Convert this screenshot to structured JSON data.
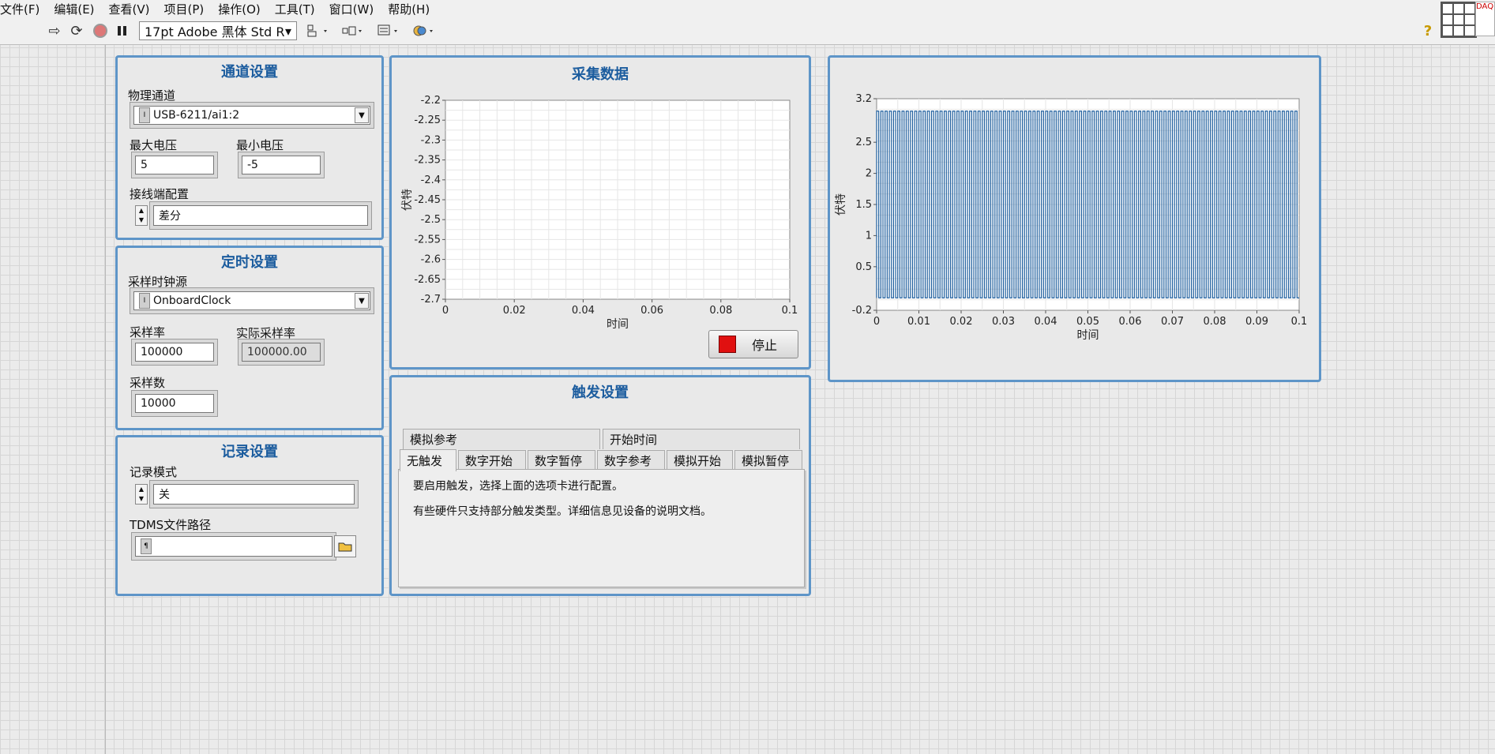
{
  "menu": [
    "文件(F)",
    "编辑(E)",
    "查看(V)",
    "项目(P)",
    "操作(O)",
    "工具(T)",
    "窗口(W)",
    "帮助(H)"
  ],
  "toolbar": {
    "font_selector": "17pt Adobe 黑体 Std R",
    "help_icon": "?"
  },
  "channel_panel": {
    "title": "通道设置",
    "physical_channel_label": "物理通道",
    "physical_channel_value": "USB-6211/ai1:2",
    "max_voltage_label": "最大电压",
    "max_voltage_value": "5",
    "min_voltage_label": "最小电压",
    "min_voltage_value": "-5",
    "terminal_config_label": "接线端配置",
    "terminal_config_value": "差分"
  },
  "timing_panel": {
    "title": "定时设置",
    "clock_source_label": "采样时钟源",
    "clock_source_value": "OnboardClock",
    "rate_label": "采样率",
    "rate_value": "100000",
    "actual_rate_label": "实际采样率",
    "actual_rate_value": "100000.00",
    "samples_label": "采样数",
    "samples_value": "10000"
  },
  "logging_panel": {
    "title": "记录设置",
    "mode_label": "记录模式",
    "mode_value": "关",
    "path_label": "TDMS文件路径",
    "path_value": ""
  },
  "acquire_panel": {
    "title": "采集数据",
    "stop_label": "停止"
  },
  "trigger_panel": {
    "title": "触发设置",
    "tabs_back": [
      "模拟参考",
      "开始时间"
    ],
    "tabs_front": [
      "无触发",
      "数字开始",
      "数字暂停",
      "数字参考",
      "模拟开始",
      "模拟暂停"
    ],
    "active_tab": "无触发",
    "line1": "要启用触发，选择上面的选项卡进行配置。",
    "line2": "有些硬件只支持部分触发类型。详细信息见设备的说明文档。"
  },
  "chart_data": [
    {
      "type": "line",
      "title": "",
      "xlabel": "时间",
      "ylabel": "伏特",
      "xlim": [
        0,
        0.1
      ],
      "ylim": [
        -2.7,
        -2.2
      ],
      "x_ticks": [
        "0",
        "0.02",
        "0.04",
        "0.06",
        "0.08",
        "0.1"
      ],
      "y_ticks": [
        "-2.2",
        "-2.25",
        "-2.3",
        "-2.35",
        "-2.4",
        "-2.45",
        "-2.5",
        "-2.55",
        "-2.6",
        "-2.65",
        "-2.7"
      ],
      "grid": true,
      "series": []
    },
    {
      "type": "line",
      "title": "",
      "xlabel": "时间",
      "ylabel": "伏特",
      "xlim": [
        0,
        0.1
      ],
      "ylim": [
        -0.2,
        3.2
      ],
      "x_ticks": [
        "0",
        "0.01",
        "0.02",
        "0.03",
        "0.04",
        "0.05",
        "0.06",
        "0.07",
        "0.08",
        "0.09",
        "0.1"
      ],
      "y_ticks": [
        "3.2",
        "2.5",
        "2",
        "1.5",
        "1",
        "0.5",
        "-0.2"
      ],
      "grid": true,
      "series": [
        {
          "color": "#1f5f9e",
          "waveform": "square",
          "low": 0,
          "high": 3.0,
          "cycles": 100,
          "xstart": 0,
          "xend": 0.1
        }
      ]
    }
  ]
}
